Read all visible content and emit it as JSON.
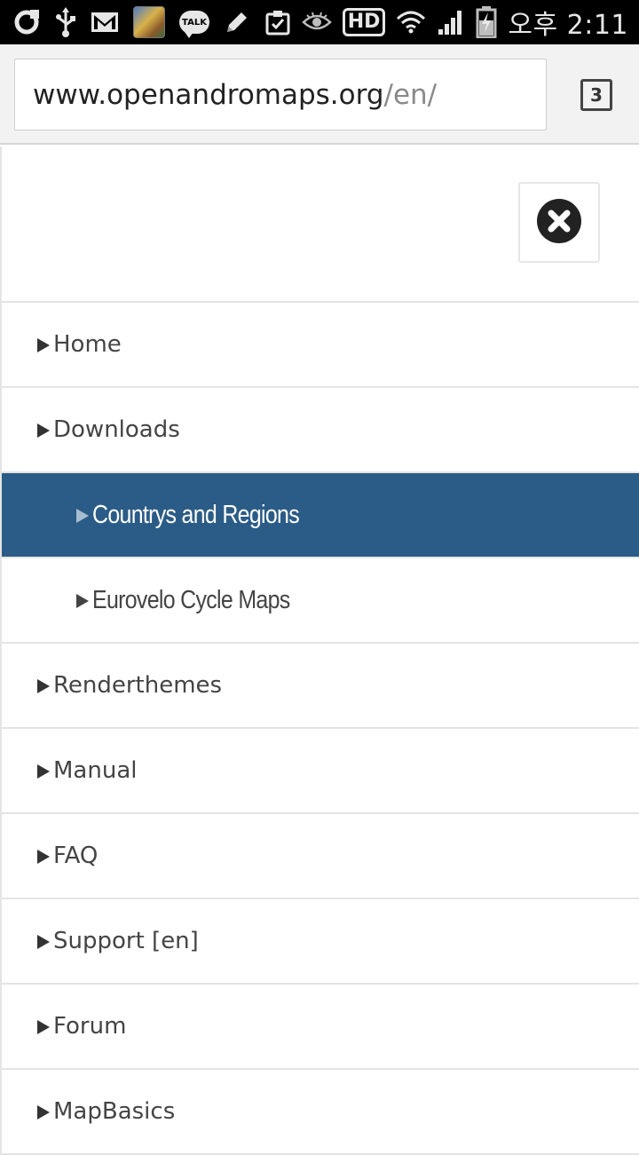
{
  "status_bar": {
    "icons_left": [
      "g-icon",
      "usb-icon",
      "gmail-icon",
      "app-thumbnail-icon",
      "talk-icon",
      "pencil-icon",
      "clipboard-check-icon"
    ],
    "talk_label": "TALK",
    "hd_label": "HD",
    "time": "오후 2:11"
  },
  "browser": {
    "url_host": "www.openandromaps.org",
    "url_path": "/en/",
    "tab_count": "3"
  },
  "menu": {
    "items": [
      {
        "label": "Home",
        "level": 1,
        "active": false
      },
      {
        "label": "Downloads",
        "level": 1,
        "active": false
      },
      {
        "label": "Countrys and Regions",
        "level": 2,
        "active": true
      },
      {
        "label": "Eurovelo Cycle Maps",
        "level": 2,
        "active": false
      },
      {
        "label": "Renderthemes",
        "level": 1,
        "active": false
      },
      {
        "label": "Manual",
        "level": 1,
        "active": false
      },
      {
        "label": "FAQ",
        "level": 1,
        "active": false
      },
      {
        "label": "Support [en]",
        "level": 1,
        "active": false
      },
      {
        "label": "Forum",
        "level": 1,
        "active": false
      },
      {
        "label": "MapBasics",
        "level": 1,
        "active": false
      }
    ]
  },
  "colors": {
    "active_bg": "#2b5c87",
    "status_bar_bg": "#000000",
    "text": "#444444"
  }
}
